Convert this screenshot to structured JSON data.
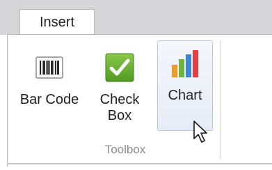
{
  "tabs": {
    "insert_label": "Insert"
  },
  "buttons": {
    "barcode": {
      "label": "Bar Code",
      "icon": "barcode-icon"
    },
    "checkbox": {
      "line1": "Check",
      "line2": "Box",
      "icon": "checkbox-icon"
    },
    "chart": {
      "label": "Chart",
      "icon": "bar-chart-icon"
    }
  },
  "group": {
    "label": "Toolbox"
  },
  "colors": {
    "tab_strip": "#d6d6d9",
    "check_green": "#6aa936",
    "chart_orange": "#f09a28",
    "chart_green": "#6cb33f",
    "chart_blue": "#3d86d4",
    "chart_red": "#e14040",
    "hover_border": "#b9c6dc"
  },
  "cursor": {
    "icon": "arrow-cursor-icon"
  }
}
